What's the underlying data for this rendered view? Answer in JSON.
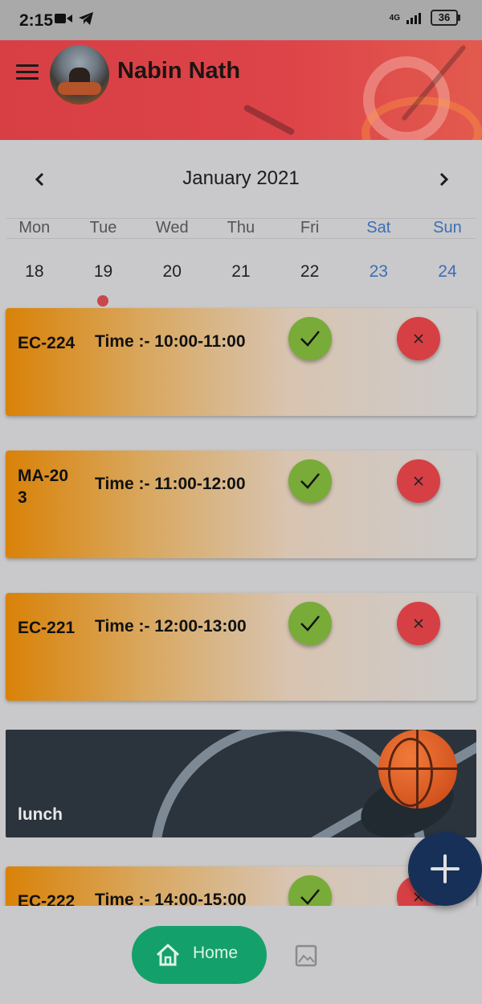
{
  "status_bar": {
    "time": "2:15",
    "network": "4G",
    "battery": "36"
  },
  "header": {
    "user_name": "Nabin Nath",
    "accent": "#d83f45"
  },
  "calendar": {
    "month_title": "January 2021",
    "weekdays": [
      "Mon",
      "Tue",
      "Wed",
      "Thu",
      "Fri",
      "Sat",
      "Sun"
    ],
    "dates": [
      "18",
      "19",
      "20",
      "21",
      "22",
      "23",
      "24"
    ],
    "weekend_color": "#3c6fb6",
    "selected_date": "19"
  },
  "schedule": [
    {
      "course": "EC-224",
      "time": "Time :- 10:00-11:00"
    },
    {
      "course": "MA-203",
      "time": "Time :- 11:00-12:00"
    },
    {
      "course": "EC-221",
      "time": "Time :- 12:00-13:00"
    },
    {
      "course": "lunch"
    },
    {
      "course": "EC-222",
      "time": "Time :- 14:00-15:00"
    }
  ],
  "icons": {
    "accept": "check-icon",
    "reject": "close-icon",
    "fab": "plus-icon",
    "home": "home-icon",
    "gallery": "image-icon"
  },
  "colors": {
    "accept": "#78ab38",
    "reject": "#d64045",
    "fab": "#173058",
    "home_pill": "#14a06a"
  },
  "bottom_nav": {
    "home_label": "Home"
  }
}
